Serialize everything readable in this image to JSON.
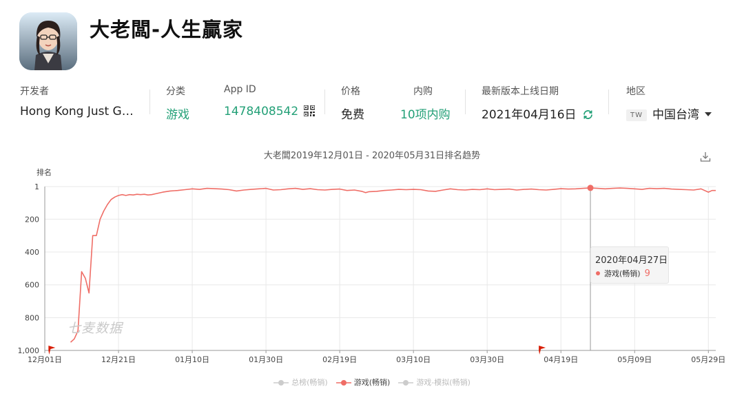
{
  "app": {
    "title": "大老闆-人生贏家",
    "icon": "app-icon-avatar"
  },
  "meta": {
    "developer_label": "开发者",
    "developer_value": "Hong Kong Just G…",
    "category_label": "分类",
    "category_value": "游戏",
    "appid_label": "App ID",
    "appid_value": "1478408542",
    "price_label": "价格",
    "price_value": "免费",
    "iap_label": "内购",
    "iap_value": "10项内购",
    "release_label": "最新版本上线日期",
    "release_value": "2021年04月16日",
    "region_label": "地区",
    "region_badge": "TW",
    "region_value": "中国台湾"
  },
  "colors": {
    "accent": "#23a077",
    "series": "#ef6d66",
    "grid": "#e8e8e8"
  },
  "chart_data": {
    "type": "line",
    "title": "大老闆2019年12月01日 - 2020年05月31日排名趋势",
    "ylabel": "排名",
    "y_reversed": true,
    "ylim": [
      1,
      1000
    ],
    "y_ticks": [
      {
        "value": 1,
        "label": "1"
      },
      {
        "value": 200,
        "label": "200"
      },
      {
        "value": 400,
        "label": "400"
      },
      {
        "value": 600,
        "label": "600"
      },
      {
        "value": 800,
        "label": "800"
      },
      {
        "value": 1000,
        "label": "1,000"
      }
    ],
    "x_ticks": [
      {
        "day": 0,
        "label": "12月01日"
      },
      {
        "day": 20,
        "label": "12月21日"
      },
      {
        "day": 40,
        "label": "01月10日"
      },
      {
        "day": 60,
        "label": "01月30日"
      },
      {
        "day": 80,
        "label": "02月19日"
      },
      {
        "day": 100,
        "label": "03月10日"
      },
      {
        "day": 120,
        "label": "03月30日"
      },
      {
        "day": 140,
        "label": "04月19日"
      },
      {
        "day": 160,
        "label": "05月09日"
      },
      {
        "day": 180,
        "label": "05月29日"
      }
    ],
    "x_max_day": 182,
    "series": [
      {
        "name": "游戏(畅销)",
        "points": [
          [
            7,
            950
          ],
          [
            8,
            930
          ],
          [
            9,
            880
          ],
          [
            10,
            520
          ],
          [
            11,
            560
          ],
          [
            12,
            650
          ],
          [
            13,
            300
          ],
          [
            14,
            300
          ],
          [
            15,
            200
          ],
          [
            16,
            150
          ],
          [
            17,
            110
          ],
          [
            18,
            80
          ],
          [
            19,
            65
          ],
          [
            20,
            55
          ],
          [
            21,
            50
          ],
          [
            22,
            55
          ],
          [
            23,
            50
          ],
          [
            24,
            52
          ],
          [
            25,
            48
          ],
          [
            26,
            50
          ],
          [
            27,
            48
          ],
          [
            28,
            52
          ],
          [
            29,
            50
          ],
          [
            30,
            45
          ],
          [
            32,
            35
          ],
          [
            34,
            28
          ],
          [
            36,
            25
          ],
          [
            38,
            20
          ],
          [
            40,
            15
          ],
          [
            42,
            18
          ],
          [
            44,
            12
          ],
          [
            46,
            14
          ],
          [
            48,
            16
          ],
          [
            50,
            20
          ],
          [
            52,
            28
          ],
          [
            54,
            22
          ],
          [
            56,
            18
          ],
          [
            58,
            15
          ],
          [
            60,
            12
          ],
          [
            62,
            22
          ],
          [
            64,
            20
          ],
          [
            66,
            15
          ],
          [
            68,
            12
          ],
          [
            70,
            18
          ],
          [
            72,
            14
          ],
          [
            74,
            20
          ],
          [
            76,
            22
          ],
          [
            78,
            18
          ],
          [
            80,
            16
          ],
          [
            82,
            25
          ],
          [
            84,
            22
          ],
          [
            86,
            30
          ],
          [
            87,
            38
          ],
          [
            88,
            32
          ],
          [
            90,
            30
          ],
          [
            92,
            25
          ],
          [
            94,
            22
          ],
          [
            96,
            18
          ],
          [
            98,
            20
          ],
          [
            100,
            18
          ],
          [
            102,
            20
          ],
          [
            104,
            28
          ],
          [
            106,
            30
          ],
          [
            108,
            22
          ],
          [
            110,
            15
          ],
          [
            112,
            20
          ],
          [
            114,
            22
          ],
          [
            116,
            18
          ],
          [
            118,
            20
          ],
          [
            120,
            15
          ],
          [
            122,
            20
          ],
          [
            124,
            18
          ],
          [
            126,
            16
          ],
          [
            128,
            22
          ],
          [
            130,
            18
          ],
          [
            132,
            16
          ],
          [
            134,
            20
          ],
          [
            136,
            22
          ],
          [
            138,
            18
          ],
          [
            140,
            14
          ],
          [
            142,
            16
          ],
          [
            144,
            15
          ],
          [
            146,
            12
          ],
          [
            148,
            9
          ],
          [
            150,
            12
          ],
          [
            152,
            15
          ],
          [
            154,
            12
          ],
          [
            156,
            10
          ],
          [
            158,
            12
          ],
          [
            160,
            15
          ],
          [
            162,
            18
          ],
          [
            164,
            12
          ],
          [
            166,
            14
          ],
          [
            168,
            12
          ],
          [
            170,
            16
          ],
          [
            172,
            18
          ],
          [
            174,
            20
          ],
          [
            176,
            22
          ],
          [
            178,
            15
          ],
          [
            180,
            35
          ],
          [
            181,
            25
          ],
          [
            182,
            25
          ]
        ]
      }
    ],
    "markers": [
      {
        "day": 1
      },
      {
        "day": 134
      }
    ],
    "highlight": {
      "day": 148,
      "date": "2020年04月27日",
      "series": "游戏(畅销)",
      "value": 9
    },
    "legend": [
      {
        "label": "总榜(畅销)",
        "active": false
      },
      {
        "label": "游戏(畅销)",
        "active": true
      },
      {
        "label": "游戏-模拟(畅销)",
        "active": false
      }
    ],
    "watermark": "七麦数据"
  }
}
